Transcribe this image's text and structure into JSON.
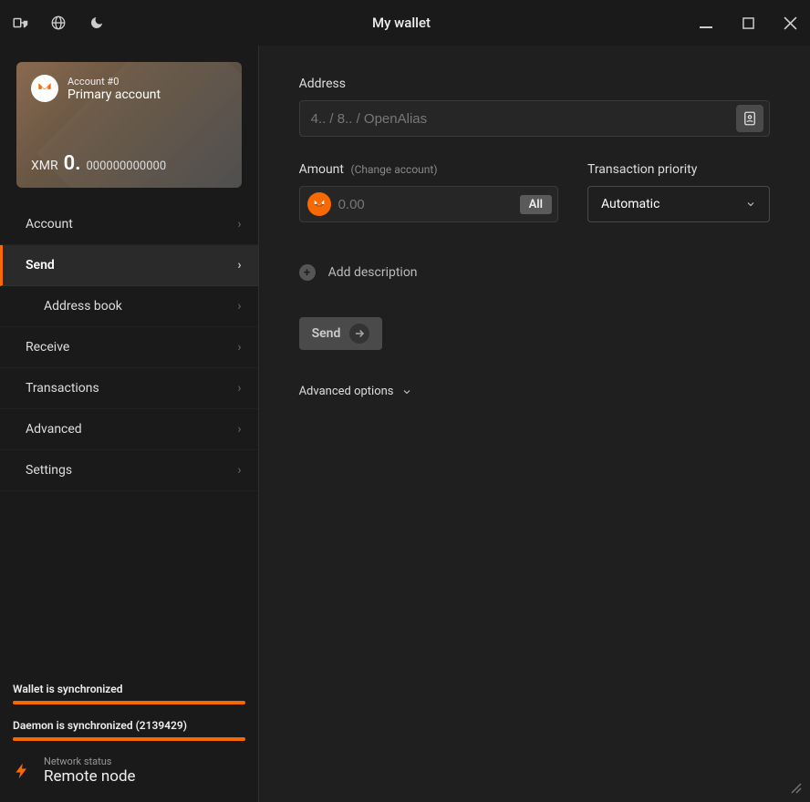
{
  "title": "My wallet",
  "account": {
    "num": "Account #0",
    "name": "Primary account",
    "currency": "XMR",
    "balance_big": "0.",
    "balance_small": "000000000000"
  },
  "nav": {
    "account": "Account",
    "send": "Send",
    "address_book": "Address book",
    "receive": "Receive",
    "transactions": "Transactions",
    "advanced": "Advanced",
    "settings": "Settings"
  },
  "sync": {
    "wallet": "Wallet is synchronized",
    "daemon": "Daemon is synchronized (2139429)"
  },
  "network": {
    "label": "Network status",
    "value": "Remote node"
  },
  "send": {
    "address_label": "Address",
    "address_placeholder": "4.. / 8.. / OpenAlias",
    "amount_label": "Amount",
    "amount_sub": "(Change account)",
    "amount_placeholder": "0.00",
    "all_btn": "All",
    "priority_label": "Transaction priority",
    "priority_value": "Automatic",
    "add_desc": "Add description",
    "send_btn": "Send",
    "advanced_options": "Advanced options"
  }
}
